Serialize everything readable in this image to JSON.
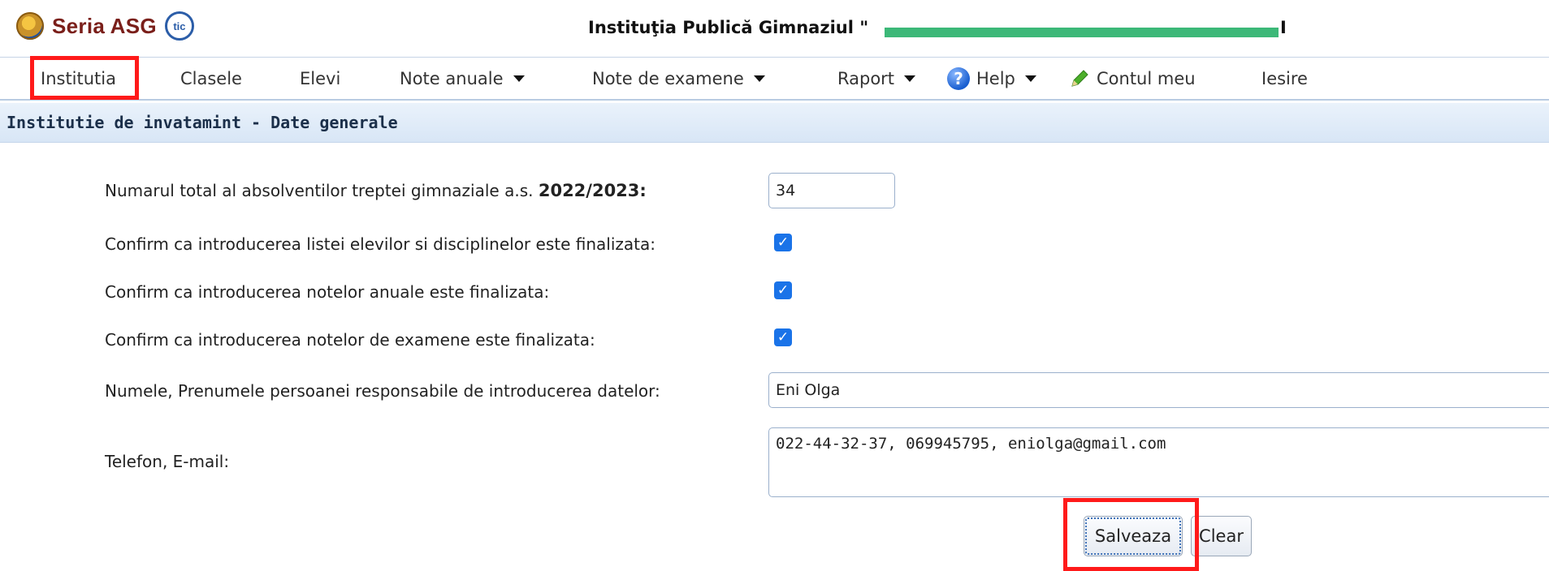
{
  "header": {
    "brand": "Seria ASG",
    "tic_logo": "tic",
    "institution_title": "Instituţia Publică Gimnaziul \"",
    "institution_title_tail": "I"
  },
  "nav": {
    "items": [
      {
        "label": "Institutia"
      },
      {
        "label": "Clasele"
      },
      {
        "label": "Elevi"
      },
      {
        "label": "Note anuale"
      },
      {
        "label": "Note de examene"
      },
      {
        "label": "Raport"
      },
      {
        "label": "Help"
      },
      {
        "label": "Contul meu"
      },
      {
        "label": "Iesire"
      }
    ]
  },
  "section": {
    "title": "Institutie de invatamint - Date generale"
  },
  "form": {
    "graduates_label": "Numarul total al absolventilor treptei gimnaziale a.s.",
    "graduates_year": "2022/2023:",
    "graduates_value": "34",
    "confirm_lists_label": "Confirm ca introducerea listei elevilor si disciplinelor este finalizata:",
    "confirm_annual_label": "Confirm ca introducerea notelor anuale este finalizata:",
    "confirm_exam_label": "Confirm ca introducerea notelor de examene este finalizata:",
    "responsible_label": "Numele, Prenumele persoanei responsabile de introducerea datelor:",
    "responsible_value": "Eni Olga",
    "contact_label": "Telefon, E-mail:",
    "contact_value": "022-44-32-37, 069945795, eniolga@gmail.com",
    "checkbox_mark": "✓"
  },
  "buttons": {
    "save_label": "Salveaza",
    "clear_label": "Clear"
  },
  "colors": {
    "highlight": "#ff1a1a",
    "checkbox": "#1a73e8",
    "redaction": "#3cb878"
  }
}
